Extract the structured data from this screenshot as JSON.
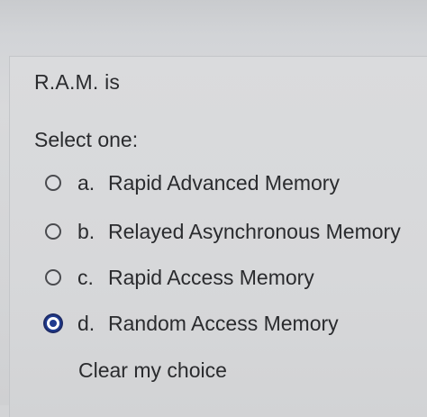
{
  "question": {
    "text": "R.A.M. is",
    "prompt": "Select one:"
  },
  "options": [
    {
      "letter": "a.",
      "text": "Rapid Advanced Memory",
      "selected": false
    },
    {
      "letter": "b.",
      "text": "Relayed Asynchronous Memory",
      "selected": false
    },
    {
      "letter": "c.",
      "text": "Rapid Access Memory",
      "selected": false
    },
    {
      "letter": "d.",
      "text": "Random Access Memory",
      "selected": true
    }
  ],
  "clear_label": "Clear my choice",
  "colors": {
    "radio_selected": "#1f3b8f",
    "text": "#2a2b2e",
    "background": "#d7d8da"
  }
}
